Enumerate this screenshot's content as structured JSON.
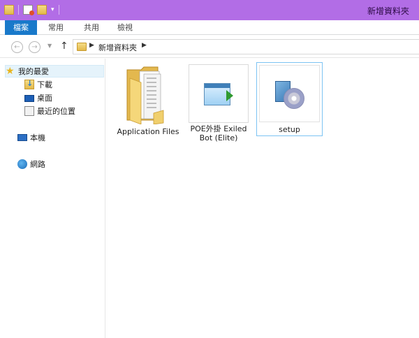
{
  "window": {
    "title": "新增資料夾"
  },
  "quick_access_toolbar": {
    "icons": [
      "folder-icon",
      "properties-icon",
      "new-folder-icon",
      "customize-dropdown-icon"
    ]
  },
  "ribbon": {
    "tabs": [
      {
        "label": "檔案",
        "active": true
      },
      {
        "label": "常用"
      },
      {
        "label": "共用"
      },
      {
        "label": "檢視"
      }
    ],
    "accent_color": "#1979ca"
  },
  "address_bar": {
    "back_icon": "back-arrow-icon",
    "forward_icon": "forward-arrow-icon",
    "up_icon": "up-arrow-icon",
    "breadcrumb": [
      "新增資料夾"
    ]
  },
  "navigation_pane": {
    "favorites": {
      "label": "我的最愛",
      "icon": "star-icon"
    },
    "favorite_items": [
      {
        "label": "下載",
        "icon": "downloads-icon"
      },
      {
        "label": "桌面",
        "icon": "desktop-icon"
      },
      {
        "label": "最近的位置",
        "icon": "recent-places-icon"
      }
    ],
    "this_pc": {
      "label": "本機",
      "icon": "computer-icon"
    },
    "network": {
      "label": "網路",
      "icon": "network-icon"
    }
  },
  "files": [
    {
      "name": "Application Files",
      "type": "folder",
      "icon": "folder-icon"
    },
    {
      "name_line1": "POE外掛 Exiled",
      "name_line2": "Bot (Elite)",
      "type": "application",
      "icon": "application-icon"
    },
    {
      "name": "setup",
      "type": "installer",
      "icon": "setup-installer-icon",
      "selected": true
    }
  ],
  "colors": {
    "titlebar": "#b26de6",
    "selection_border": "#7cc3f3"
  }
}
